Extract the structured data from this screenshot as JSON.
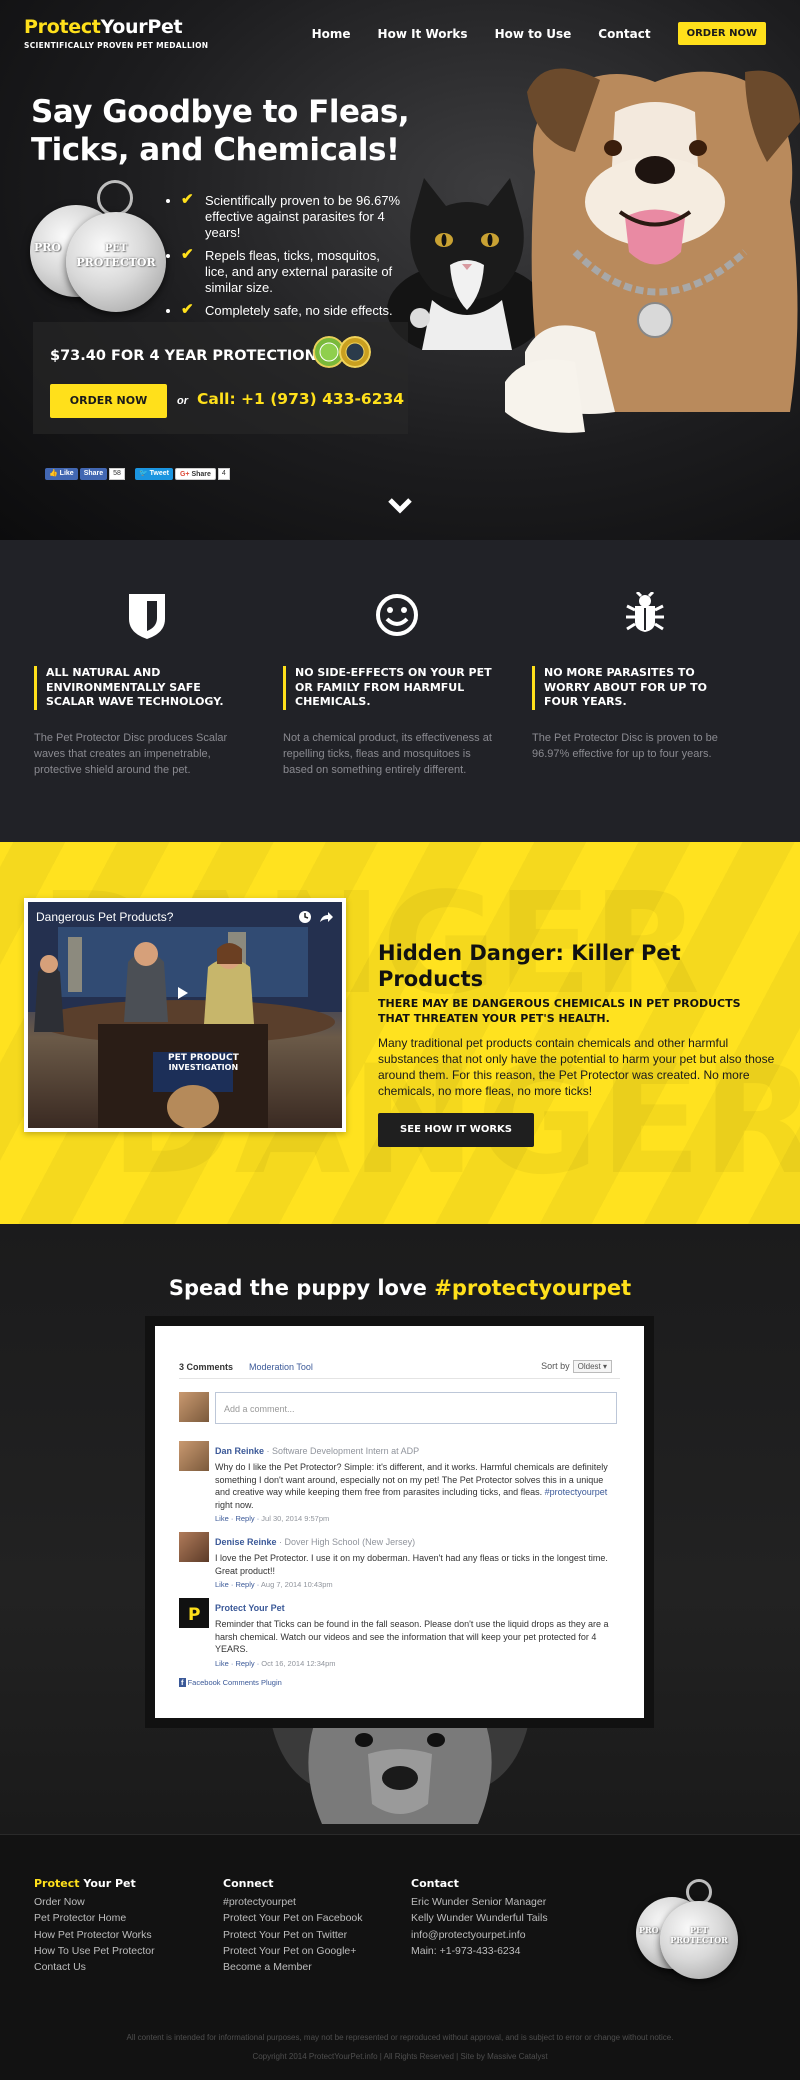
{
  "brand": {
    "name_part1": "Protect",
    "name_part2": "YourPet",
    "tagline": "SCIENTIFICALLY PROVEN PET MEDALLION"
  },
  "nav": {
    "items": [
      "Home",
      "How It Works",
      "How to Use",
      "Contact"
    ],
    "order_label": "ORDER NOW"
  },
  "hero": {
    "title": "Say Goodbye to Fleas, Ticks, and Chemicals!",
    "medal_front_text_1": "PET",
    "medal_front_text_2": "PROTECTOR",
    "medal_back_text": "PRO",
    "checks": [
      "Scientifically proven to be 96.67% effective against parasites for 4 years!",
      "Repels fleas, ticks, mosquitos, lice, and any external parasite of similar size.",
      "Completely safe, no side effects."
    ],
    "price": "$73.40 FOR 4 YEAR PROTECTION!",
    "order_label": "ORDER NOW",
    "or": "or",
    "call": "Call: +1 (973) 433-6234",
    "social": {
      "like": "Like",
      "share": "Share",
      "share_count": "58",
      "tweet": "Tweet",
      "gplus": "Share",
      "gplus_count": "4"
    }
  },
  "features": [
    {
      "icon": "shield-icon",
      "title": "ALL NATURAL AND ENVIRONMENTALLY SAFE SCALAR WAVE TECHNOLOGY.",
      "body": "The Pet Protector Disc produces Scalar waves that creates an impenetrable, protective shield around the pet."
    },
    {
      "icon": "smiley-icon",
      "title": "NO SIDE-EFFECTS ON YOUR PET OR FAMILY FROM HARMFUL CHEMICALS.",
      "body": "Not a chemical product, its effectiveness at repelling ticks, fleas and mosquitoes is based on something entirely different."
    },
    {
      "icon": "bug-icon",
      "title": "NO MORE PARASITES TO WORRY ABOUT FOR UP TO FOUR YEARS.",
      "body": "The Pet Protector Disc is proven to be 96.97% effective for up to four years."
    }
  ],
  "danger": {
    "video_title": "Dangerous Pet Products?",
    "video_banner_1": "PET PRODUCT",
    "video_banner_2": "INVESTIGATION",
    "title": "Hidden Danger: Killer Pet Products",
    "subtitle": "THERE MAY BE DANGEROUS CHEMICALS IN PET PRODUCTS THAT THREATEN YOUR PET'S HEALTH.",
    "body": "Many traditional pet products contain chemicals and other harmful substances that not only have the potential to harm your pet but also those around them. For this reason, the Pet Protector was created. No more chemicals, no more fleas, no more ticks!",
    "button": "SEE HOW IT WORKS"
  },
  "love": {
    "title_part1": "Spead the puppy love ",
    "title_part2": "#protectyourpet",
    "comments_count": "3 Comments",
    "moderation": "Moderation Tool",
    "sort_label": "Sort by",
    "sort_value": "Oldest",
    "input_placeholder": "Add a comment...",
    "comments": [
      {
        "name": "Dan Reinke",
        "meta": " · Software Development Intern at ADP",
        "text": "Why do I like the Pet Protector? Simple: it's different, and it works. Harmful chemicals are definitely something I don't want around, especially not on my pet! The Pet Protector solves this in a unique and creative way while keeping them free from parasites including ticks, and fleas. ",
        "tag": "#protectyourpet",
        "text_end": " right now.",
        "like": "Like",
        "reply": "Reply",
        "date": "Jul 30, 2014 9:57pm"
      },
      {
        "name": "Denise Reinke",
        "meta": " · Dover High School (New Jersey)",
        "text": "I love the Pet Protector. I use it on my doberman. Haven't had any fleas or ticks in the longest time. Great product!!",
        "like": "Like",
        "reply": "Reply",
        "date": "Aug 7, 2014 10:43pm"
      },
      {
        "name": "Protect Your Pet",
        "meta": "",
        "text": "Reminder that Ticks can be found in the fall season. Please don't use the liquid drops as they are a harsh chemical. Watch our videos and see the information that will keep your pet protected for 4 YEARS.",
        "like": "Like",
        "reply": "Reply",
        "date": "Oct 16, 2014 12:34pm"
      }
    ],
    "plugin": "Facebook Comments Plugin"
  },
  "footer": {
    "col1": {
      "head_part1": "Protect",
      "head_part2": " Your Pet",
      "links": [
        "Order Now",
        "Pet Protector Home",
        "How Pet Protector Works",
        "How To Use Pet Protector",
        "Contact Us"
      ]
    },
    "col2": {
      "head": "Connect",
      "links": [
        "#protectyourpet",
        "Protect Your Pet on Facebook",
        "Protect Your Pet on Twitter",
        "Protect Your Pet on Google+",
        "Become a Member"
      ]
    },
    "col3": {
      "head": "Contact",
      "links": [
        "Eric Wunder Senior Manager",
        "Kelly Wunder Wunderful Tails",
        "info@protectyourpet.info",
        "Main: +1-973-433-6234"
      ]
    },
    "disclaimer": "All content is intended for informational purposes, may not be represented or reproduced without approval, and is subject to error or change without notice.",
    "copyright": "Copyright 2014 ProtectYourPet.info | All Rights Reserved | Site by Massive Catalyst"
  }
}
